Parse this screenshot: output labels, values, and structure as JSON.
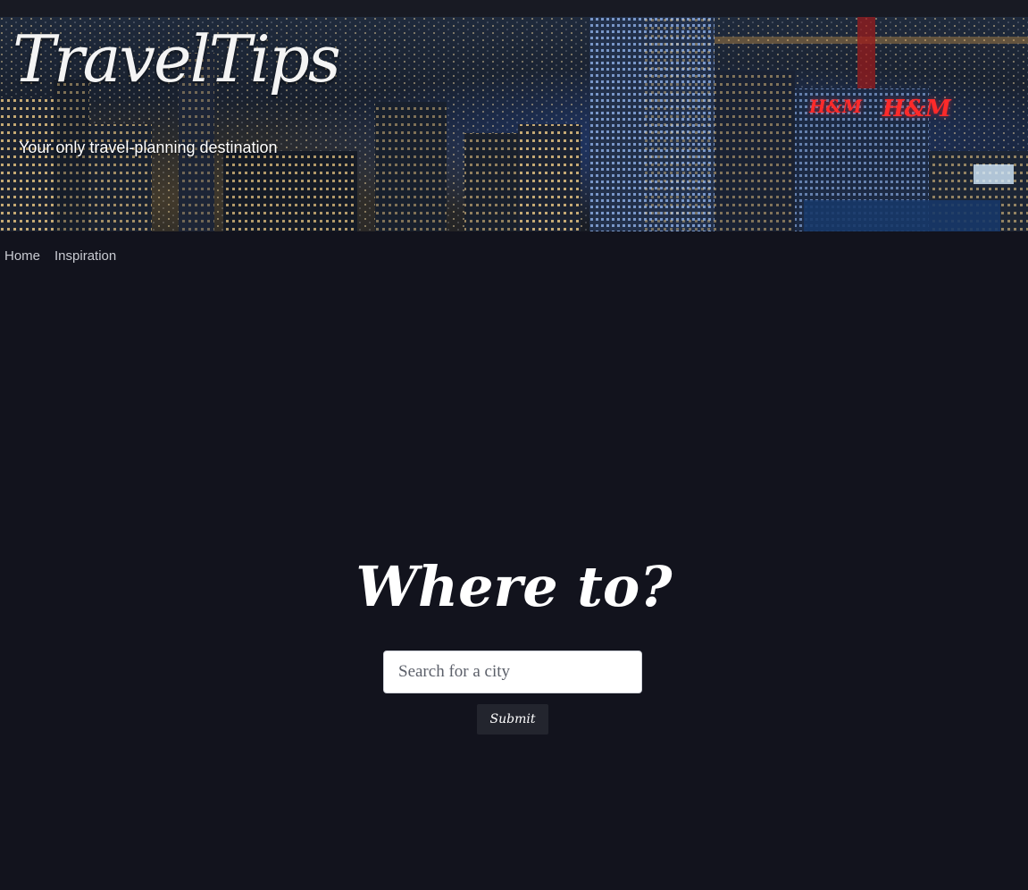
{
  "header": {
    "brand": "TravelTips",
    "tagline": "Your only travel-planning destination",
    "signs": [
      "H&M",
      "H&M"
    ]
  },
  "nav": {
    "items": [
      {
        "label": "Home"
      },
      {
        "label": "Inspiration"
      }
    ]
  },
  "main": {
    "headline": "Where to?",
    "search_placeholder": "Search for a city",
    "search_value": "",
    "submit_label": "Submit"
  },
  "colors": {
    "background": "#12131d",
    "nav_text": "#c9cbd2",
    "button_bg": "#23252e",
    "sign_red": "#ff2a2a"
  },
  "icons": {
    "hero_image": "city-skyline-night-image"
  }
}
